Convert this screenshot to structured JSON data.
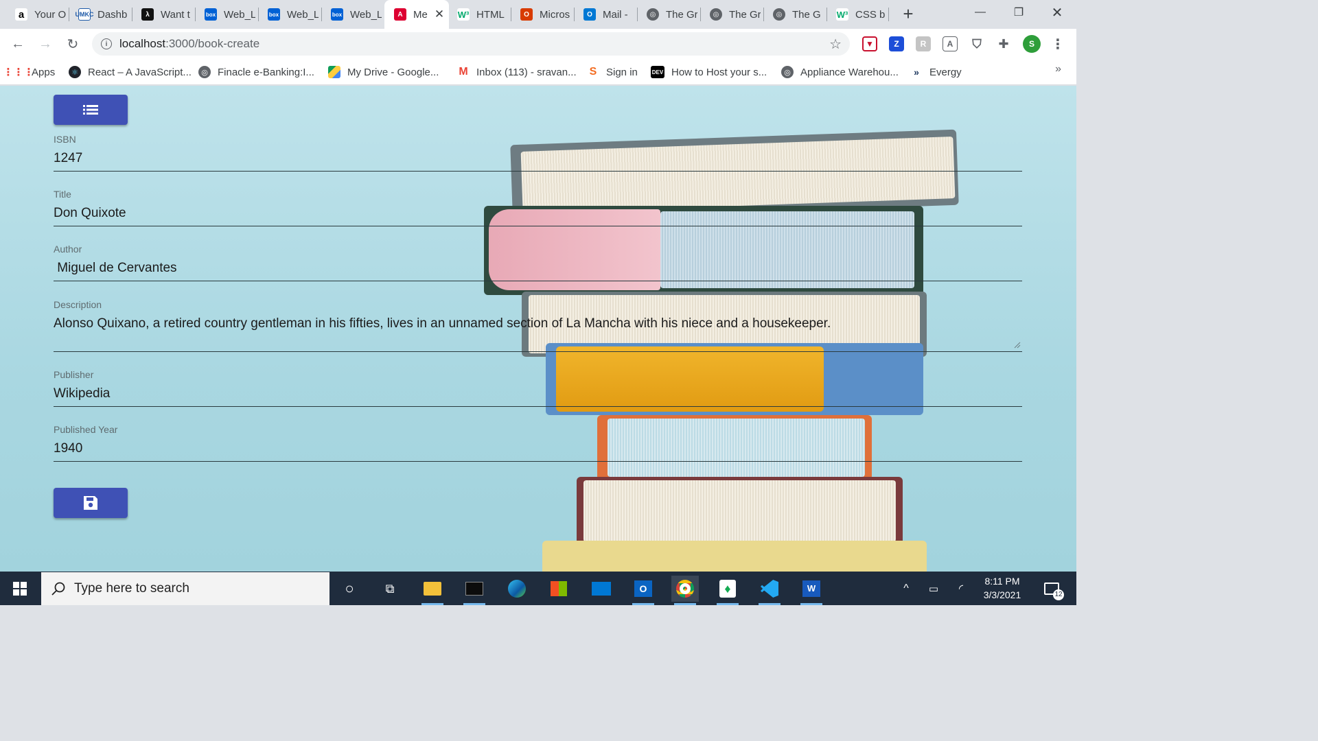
{
  "browser": {
    "tabs": [
      {
        "title": "Your O",
        "icon": "amazon-icon",
        "active": false
      },
      {
        "title": "Dashb",
        "icon": "umkc-icon",
        "active": false
      },
      {
        "title": "Want t",
        "icon": "lambda-icon",
        "active": false
      },
      {
        "title": "Web_L",
        "icon": "box-icon",
        "active": false
      },
      {
        "title": "Web_L",
        "icon": "box-icon",
        "active": false
      },
      {
        "title": "Web_L",
        "icon": "box-icon",
        "active": false
      },
      {
        "title": "Me",
        "icon": "angular-icon",
        "active": true
      },
      {
        "title": "HTML",
        "icon": "w3schools-icon",
        "active": false
      },
      {
        "title": "Micros",
        "icon": "office-icon",
        "active": false
      },
      {
        "title": "Mail -",
        "icon": "outlook-icon",
        "active": false
      },
      {
        "title": "The Gr",
        "icon": "globe-icon",
        "active": false
      },
      {
        "title": "The Gr",
        "icon": "globe-icon",
        "active": false
      },
      {
        "title": "The G",
        "icon": "globe-icon",
        "active": false
      },
      {
        "title": "CSS b",
        "icon": "w3schools-icon",
        "active": false
      }
    ],
    "address": {
      "host": "localhost",
      "path": ":3000/book-create"
    },
    "bookmarks": [
      {
        "label": "Apps",
        "icon": "apps-grid-icon"
      },
      {
        "label": "React – A JavaScript...",
        "icon": "react-icon"
      },
      {
        "label": "Finacle e-Banking:I...",
        "icon": "globe-icon"
      },
      {
        "label": "My Drive - Google...",
        "icon": "google-drive-icon"
      },
      {
        "label": "Inbox (113) - sravan...",
        "icon": "gmail-icon"
      },
      {
        "label": "Sign in",
        "icon": "sign-in-icon"
      },
      {
        "label": "How to Host your s...",
        "icon": "dev-icon"
      },
      {
        "label": "Appliance Warehou...",
        "icon": "globe-icon"
      },
      {
        "label": "Evergy",
        "icon": "evergy-icon"
      }
    ],
    "profile_initial": "S"
  },
  "form": {
    "fields": [
      {
        "label": "ISBN",
        "value": "1247"
      },
      {
        "label": "Title",
        "value": "Don Quixote"
      },
      {
        "label": "Author",
        "value": " Miguel de Cervantes"
      },
      {
        "label": "Description",
        "value": "Alonso Quixano, a retired country gentleman in his fifties, lives in an unnamed section of La Mancha with his niece and a housekeeper."
      },
      {
        "label": "Publisher",
        "value": "Wikipedia"
      },
      {
        "label": "Published Year",
        "value": "1940"
      }
    ],
    "list_button_icon": "list-icon",
    "save_button_icon": "save-icon"
  },
  "taskbar": {
    "search_placeholder": "Type here to search",
    "time": "8:11 PM",
    "date": "3/3/2021",
    "notification_count": "12"
  }
}
